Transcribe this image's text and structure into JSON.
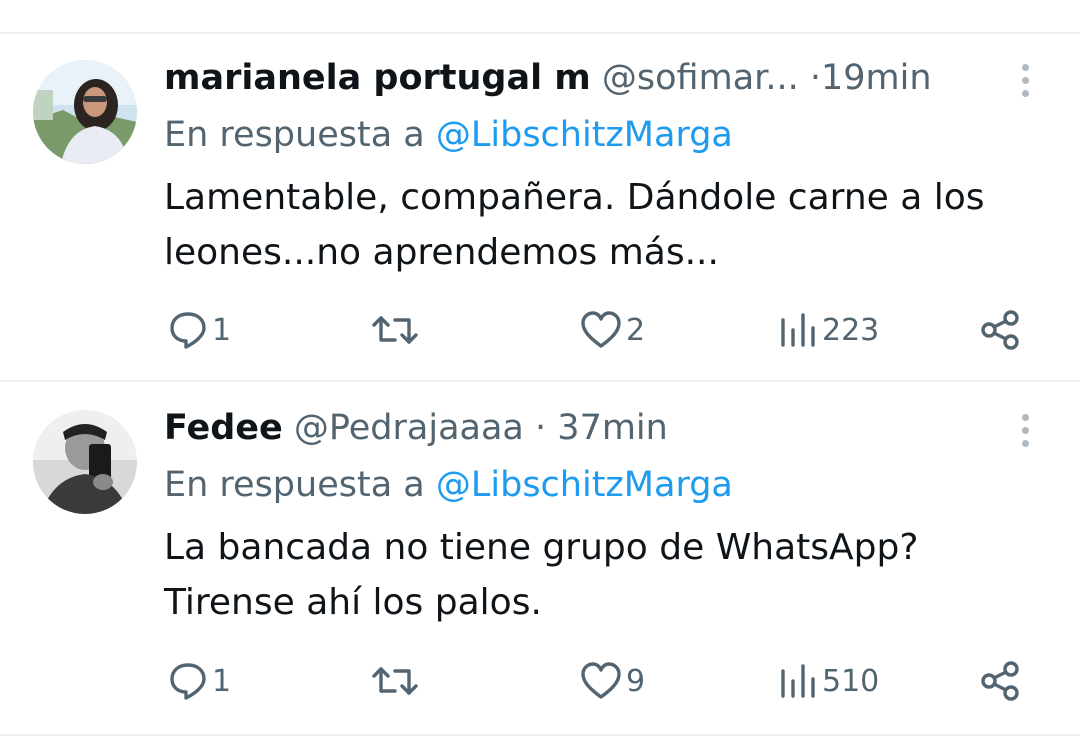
{
  "tweets": [
    {
      "name": "marianela portugal m",
      "handle": "@sofimar...",
      "dot": "·",
      "time": "19min",
      "reply_prefix": "En respuesta a",
      "reply_to": "@LibschitzMarga",
      "text_line1": "Lamentable, compañera. Dándole carne a los",
      "text_line2": "leones...no aprendemos más...",
      "replies": "1",
      "retweets": "",
      "likes": "2",
      "views": "223"
    },
    {
      "name": "Fedee",
      "handle": "@Pedrajaaaa",
      "dot": "·",
      "time": "37min",
      "reply_prefix": "En respuesta a",
      "reply_to": "@LibschitzMarga",
      "text_line1": "La bancada no tiene grupo de WhatsApp?",
      "text_line2": "Tirense ahí los palos.",
      "replies": "1",
      "retweets": "",
      "likes": "9",
      "views": "510"
    }
  ],
  "icons": {
    "reply": "reply-icon",
    "retweet": "retweet-icon",
    "like": "heart-icon",
    "views": "views-chart-icon",
    "share": "share-icon",
    "more": "more-vertical-icon"
  },
  "colors": {
    "text": "#0f1419",
    "secondary": "#536471",
    "link": "#1d9bf0",
    "divider": "#eff3f4"
  }
}
